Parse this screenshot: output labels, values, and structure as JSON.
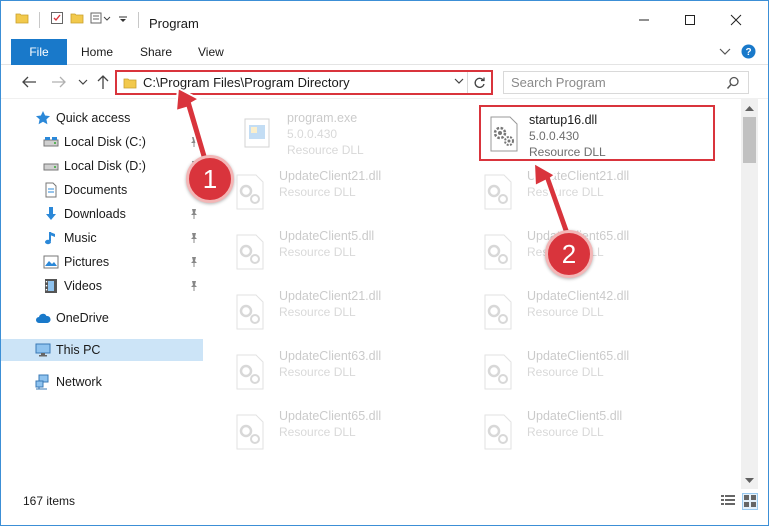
{
  "window": {
    "title": "Program"
  },
  "ribbon": {
    "tabs": [
      {
        "label": "File"
      },
      {
        "label": "Home"
      },
      {
        "label": "Share"
      },
      {
        "label": "View"
      }
    ]
  },
  "address": {
    "path": "C:\\Program Files\\Program Directory"
  },
  "search": {
    "placeholder": "Search Program"
  },
  "sidebar": {
    "items": [
      {
        "label": "Quick access",
        "icon": "star-icon"
      },
      {
        "label": "Local Disk (C:)",
        "icon": "drive-icon"
      },
      {
        "label": "Local Disk (D:)",
        "icon": "drive-icon"
      },
      {
        "label": "Documents",
        "icon": "documents-icon"
      },
      {
        "label": "Downloads",
        "icon": "download-arrow-icon"
      },
      {
        "label": "Music",
        "icon": "music-note-icon"
      },
      {
        "label": "Pictures",
        "icon": "pictures-icon"
      },
      {
        "label": "Videos",
        "icon": "film-icon"
      },
      {
        "label": "OneDrive",
        "icon": "cloud-icon"
      },
      {
        "label": "This PC",
        "icon": "monitor-icon"
      },
      {
        "label": "Network",
        "icon": "network-icon"
      }
    ]
  },
  "files": [
    {
      "name": "program.exe",
      "version": "5.0.0.430",
      "type": "Resource DLL"
    },
    {
      "name": "startup16.dll",
      "version": "5.0.0.430",
      "type": "Resource DLL"
    },
    {
      "name": "UpdateClient21.dll",
      "version": "",
      "type": "Resource DLL"
    },
    {
      "name": "UpdateClient21.dll",
      "version": "",
      "type": "Resource DLL"
    },
    {
      "name": "UpdateClient5.dll",
      "version": "",
      "type": "Resource DLL"
    },
    {
      "name": "UpdateClient65.dll",
      "version": "",
      "type": "Resource DLL"
    },
    {
      "name": "UpdateClient21.dll",
      "version": "",
      "type": "Resource DLL"
    },
    {
      "name": "UpdateClient42.dll",
      "version": "",
      "type": "Resource DLL"
    },
    {
      "name": "UpdateClient63.dll",
      "version": "",
      "type": "Resource DLL"
    },
    {
      "name": "UpdateClient65.dll",
      "version": "",
      "type": "Resource DLL"
    },
    {
      "name": "UpdateClient65.dll",
      "version": "",
      "type": "Resource DLL"
    },
    {
      "name": "UpdateClient5.dll",
      "version": "",
      "type": "Resource DLL"
    }
  ],
  "status": {
    "item_count": "167 items"
  },
  "callouts": [
    {
      "label": "1"
    },
    {
      "label": "2"
    }
  ],
  "colors": {
    "accent": "#1979ca",
    "highlight": "#d9343c",
    "selected": "#cce4f7"
  }
}
